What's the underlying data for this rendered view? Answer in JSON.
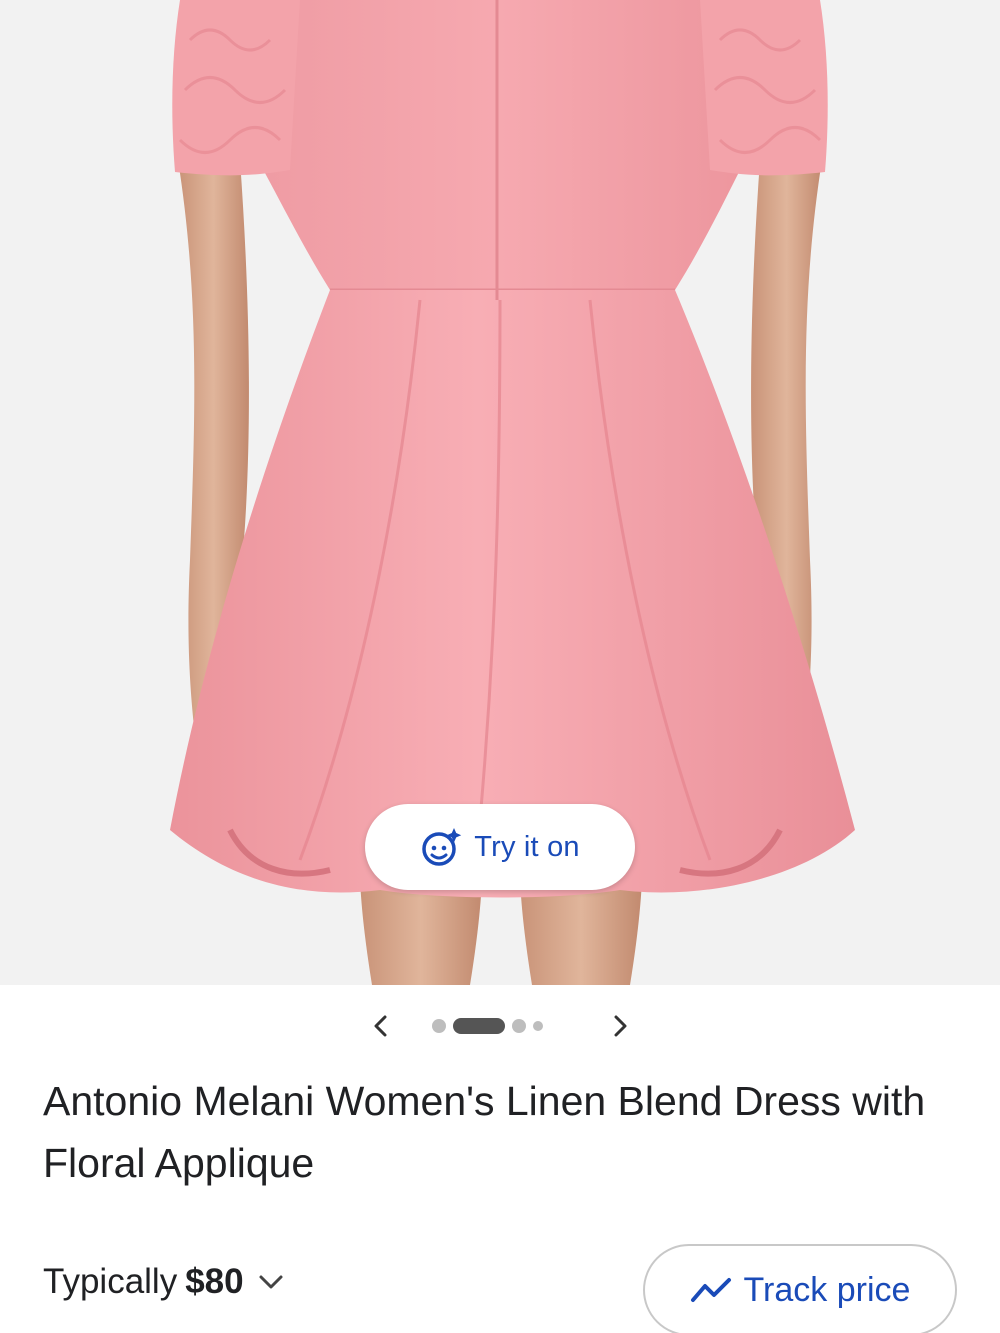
{
  "product": {
    "title": "Antonio Melani Women's Linen Blend Dress with Floral Applique",
    "image_alt": "Pink linen blend dress, back view"
  },
  "try_on": {
    "label": "Try it on",
    "icon": "face-sparkle-icon"
  },
  "carousel": {
    "prev_icon": "chevron-left-icon",
    "next_icon": "chevron-right-icon",
    "page_count": 4,
    "active_index": 1
  },
  "price": {
    "prefix": "Typically",
    "value": "$80",
    "chevron_icon": "chevron-down-icon"
  },
  "track_price": {
    "label": "Track price",
    "icon": "trending-line-icon"
  },
  "colors": {
    "accent": "#1a4bb8",
    "dress": "#f2a3ab",
    "background": "#f2f2f2"
  }
}
